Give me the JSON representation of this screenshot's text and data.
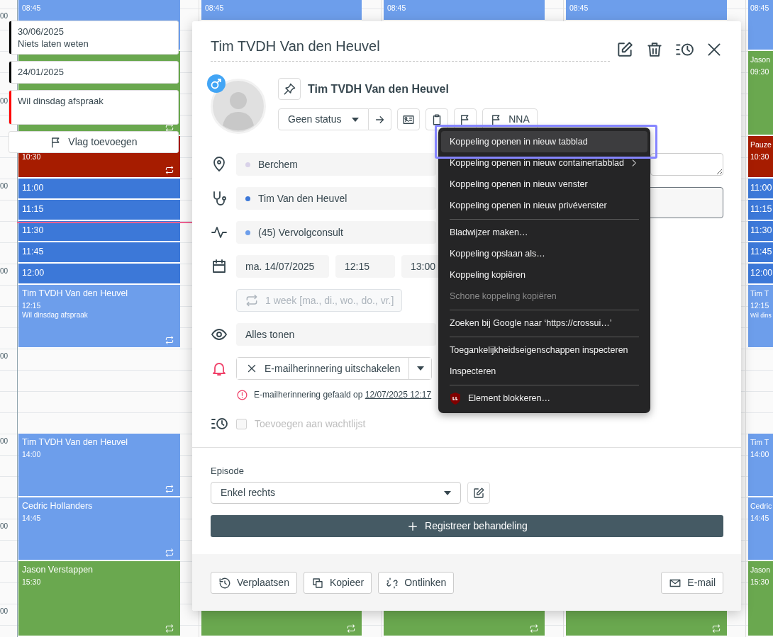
{
  "calendar": {
    "hour_labels": [
      "00",
      "00",
      "00",
      "00",
      "00",
      "00",
      "00",
      "00"
    ],
    "columns": [
      {
        "events": [
          {
            "kind": "appointment",
            "time": "08:45",
            "color": "#6d9eeb",
            "repeat": false
          },
          {
            "kind": "appointment",
            "color": "#6aa84f",
            "repeat": true
          },
          {
            "kind": "appointment",
            "time": "10:30",
            "color": "#a61c00",
            "repeat": true
          },
          {
            "kind": "slot",
            "time": "11:00",
            "color": "#3c78d8",
            "repeat": false
          },
          {
            "kind": "slot",
            "time": "11:15",
            "color": "#3c78d8",
            "repeat": false
          },
          {
            "kind": "slot",
            "time": "11:30",
            "color": "#3c78d8",
            "repeat": false
          },
          {
            "kind": "slot",
            "time": "11:45",
            "color": "#3c78d8",
            "repeat": false
          },
          {
            "kind": "slot",
            "time": "12:00",
            "color": "#3c78d8",
            "repeat": false
          },
          {
            "kind": "appointment",
            "title": "Tim TVDH Van den Heuvel",
            "time": "12:15",
            "note": "Wil dinsdag afspraak",
            "color": "#6d9eeb",
            "repeat": true
          },
          {
            "kind": "appointment",
            "title": "Tim TVDH Van den Heuvel",
            "time": "14:00",
            "color": "#6d9eeb",
            "repeat": true
          },
          {
            "kind": "appointment",
            "title": "Cedric Hollanders",
            "time": "14:45",
            "color": "#6d9eeb",
            "repeat": true
          },
          {
            "kind": "appointment",
            "title": "Jason Verstappen",
            "time": "15:30",
            "color": "#6aa84f",
            "repeat": true
          }
        ]
      },
      {
        "events": [
          {
            "kind": "appointment",
            "time": "08:45",
            "color": "#6d9eeb",
            "repeat": false
          },
          {
            "kind": "appointment",
            "color": "#6aa84f",
            "repeat": true
          }
        ]
      },
      {
        "events": [
          {
            "kind": "appointment",
            "time": "08:45",
            "color": "#6d9eeb",
            "repeat": false
          },
          {
            "kind": "appointment",
            "color": "#6aa84f",
            "repeat": true
          }
        ]
      },
      {
        "events": [
          {
            "kind": "appointment",
            "time": "08:45",
            "color": "#6d9eeb",
            "repeat": false
          },
          {
            "kind": "appointment",
            "color": "#6aa84f",
            "repeat": true
          }
        ]
      },
      {
        "events": [
          {
            "kind": "appointment",
            "time": "08:45",
            "color": "#6d9eeb",
            "repeat": false
          },
          {
            "kind": "appointment",
            "title": "Jason",
            "time": "09:30",
            "color": "#6aa84f",
            "repeat": false
          },
          {
            "kind": "appointment",
            "title": "Pauze",
            "time": "10:30",
            "color": "#a61c00",
            "repeat": false
          },
          {
            "kind": "slot",
            "time": "11:00",
            "color": "#3c78d8",
            "repeat": false
          },
          {
            "kind": "slot",
            "time": "11:15",
            "color": "#3c78d8",
            "repeat": false
          },
          {
            "kind": "slot",
            "time": "11:30",
            "color": "#3c78d8",
            "repeat": false
          },
          {
            "kind": "slot",
            "time": "11:45",
            "color": "#3c78d8",
            "repeat": false
          },
          {
            "kind": "slot",
            "time": "12:00",
            "color": "#3c78d8",
            "repeat": false
          },
          {
            "kind": "appointment",
            "title": "Tim T",
            "time": "12:15",
            "note": "Wil dins",
            "color": "#6d9eeb",
            "repeat": false
          },
          {
            "kind": "appointment",
            "title": "Tim T",
            "time": "14:00",
            "color": "#6d9eeb",
            "repeat": false
          },
          {
            "kind": "appointment",
            "title": "Cedric",
            "time": "14:45",
            "color": "#6d9eeb",
            "repeat": false
          },
          {
            "kind": "appointment",
            "title": "Jason",
            "time": "15:30",
            "color": "#6aa84f",
            "repeat": false
          }
        ]
      }
    ]
  },
  "flag_popover": {
    "flags": [
      {
        "date": "30/06/2025",
        "text": "Niets laten weten",
        "color": "#000000"
      },
      {
        "date": "24/01/2025",
        "color": "#000000"
      },
      {
        "text": "Wil dinsdag afspraak",
        "color": "#ff0000"
      }
    ],
    "add_button": "Vlag toevoegen"
  },
  "dialog": {
    "title": "Tim TVDH Van den Heuvel",
    "patient_name": "Tim TVDH Van den Heuvel",
    "status": "Geen status",
    "flag_label": "NNA",
    "location": {
      "value": "Berchem",
      "color": "#d9d2e9"
    },
    "practitioner": {
      "value": "Tim Van den Heuvel",
      "color": "#3c78d8"
    },
    "appointment_type": {
      "value": "(45) Vervolgconsult",
      "color": "#6d9eeb"
    },
    "date": "ma. 14/07/2025",
    "start_time": "12:15",
    "end_time": "13:00",
    "recurrence": {
      "label": "1 week [ma., di., wo., do., vr.]",
      "disabled": true
    },
    "visibility": "Alles tonen",
    "reminder": "E-mailherinnering uitschakelen",
    "reminder_error": {
      "text": "E-mailherinnering gefaald op",
      "link": "12/07/2025 12:17"
    },
    "waitlist": {
      "label": "Toevoegen aan wachtlijst",
      "checked": false,
      "disabled": true
    },
    "episode": {
      "label": "Episode",
      "value": "Enkel rechts"
    },
    "register_button": "Registreer behandeling",
    "footer_buttons": [
      "Verplaatsen",
      "Kopieer",
      "Ontlinken"
    ],
    "email_button": "E-mail"
  },
  "context_menu": {
    "items": [
      {
        "kind": "item",
        "label": "Koppeling openen in nieuw tabblad",
        "selected": true,
        "disabled": false,
        "submenu": false
      },
      {
        "kind": "item",
        "label": "Koppeling openen in nieuw containertabblad",
        "selected": false,
        "disabled": false,
        "submenu": true
      },
      {
        "kind": "item",
        "label": "Koppeling openen in nieuw venster",
        "selected": false,
        "disabled": false,
        "submenu": false
      },
      {
        "kind": "item",
        "label": "Koppeling openen in nieuw privévenster",
        "selected": false,
        "disabled": false,
        "submenu": false
      },
      {
        "kind": "separator"
      },
      {
        "kind": "item",
        "label": "Bladwijzer maken…",
        "selected": false,
        "disabled": false,
        "submenu": false
      },
      {
        "kind": "item",
        "label": "Koppeling opslaan als…",
        "selected": false,
        "disabled": false,
        "submenu": false
      },
      {
        "kind": "item",
        "label": "Koppeling kopiëren",
        "selected": false,
        "disabled": false,
        "submenu": false
      },
      {
        "kind": "item",
        "label": "Schone koppeling kopiëren",
        "selected": false,
        "disabled": true,
        "submenu": false
      },
      {
        "kind": "separator"
      },
      {
        "kind": "item",
        "label": "Zoeken bij Google naar ‘https://crossui…’",
        "selected": false,
        "disabled": false,
        "submenu": false
      },
      {
        "kind": "separator"
      },
      {
        "kind": "item",
        "label": "Toegankelijkheidseigenschappen inspecteren",
        "selected": false,
        "disabled": false,
        "submenu": false
      },
      {
        "kind": "item",
        "label": "Inspecteren",
        "selected": false,
        "disabled": false,
        "submenu": false
      },
      {
        "kind": "separator"
      },
      {
        "kind": "extension",
        "label": "Element blokkeren…",
        "selected": false,
        "disabled": false,
        "submenu": false
      }
    ]
  }
}
